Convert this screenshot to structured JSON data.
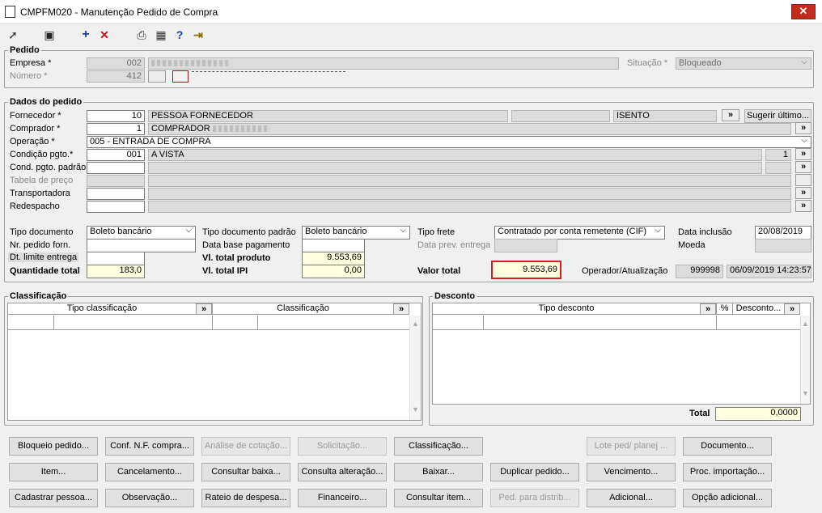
{
  "window": {
    "title": "CMPFM020 - Manutenção Pedido de Compra",
    "close": "✕"
  },
  "toolbar": {
    "arrow": "➚",
    "save": "▣",
    "add": "+",
    "delete": "✕",
    "print": "⎙",
    "grid": "▦",
    "help": "?",
    "exit": "⇥"
  },
  "pedido": {
    "group_label": "Pedido",
    "empresa_label": "Empresa *",
    "empresa_code": "002",
    "numero_label": "Número *",
    "numero_value": "412",
    "situacao_label": "Situação *",
    "situacao_value": "Bloqueado"
  },
  "dados": {
    "group_label": "Dados do pedido",
    "fornecedor_label": "Fornecedor *",
    "fornecedor_code": "10",
    "fornecedor_name": "PESSOA FORNECEDOR",
    "fornecedor_status": "ISENTO",
    "sugerir_button": "Sugerir último...",
    "comprador_label": "Comprador *",
    "comprador_code": "1",
    "comprador_name": "COMPRADOR",
    "operacao_label": "Operação *",
    "operacao_value": "005 - ENTRADA DE COMPRA",
    "condicao_label": "Condição pgto.*",
    "condicao_code": "001",
    "condicao_name": "A VISTA",
    "condicao_parcelas": "1",
    "cond_padrao_label": "Cond. pgto. padrão",
    "tabela_label": "Tabela de preço",
    "transportadora_label": "Transportadora",
    "redespacho_label": "Redespacho",
    "tipo_documento_label": "Tipo documento",
    "tipo_documento_value": "Boleto bancário",
    "tipo_documento_padrao_label": "Tipo documento padrão",
    "tipo_documento_padrao_value": "Boleto bancário",
    "tipo_frete_label": "Tipo frete",
    "tipo_frete_value": "Contratado por conta remetente (CIF)",
    "data_inclusao_label": "Data inclusão",
    "data_inclusao_value": "20/08/2019",
    "nr_pedido_label": "Nr. pedido forn.",
    "data_base_label": "Data base pagamento",
    "data_prev_label": "Data prev. entrega",
    "moeda_label": "Moeda",
    "dt_limite_label": "Dt. limite entrega",
    "vl_total_produto_label": "Vl. total produto",
    "vl_total_produto_value": "9.553,69",
    "quantidade_total_label": "Quantidade total",
    "quantidade_total_value": "183,0",
    "vl_total_ipi_label": "Vl. total IPI",
    "vl_total_ipi_value": "0,00",
    "valor_total_label": "Valor total",
    "valor_total_value": "9.553,69",
    "operador_label": "Operador/Atualização",
    "operador_value": "999998",
    "atualizacao_value": "06/09/2019 14:23:57"
  },
  "classificacao": {
    "group_label": "Classificação",
    "col1": "Tipo classificação",
    "col2": "Classificação"
  },
  "desconto": {
    "group_label": "Desconto",
    "col1": "Tipo desconto",
    "col2": "%",
    "col3": "Desconto...",
    "total_label": "Total",
    "total_value": "0,0000"
  },
  "expand": "»",
  "buttons": {
    "row1": [
      "Bloqueio pedido...",
      "Conf. N.F. compra...",
      "Análise de cotação...",
      "Solicitação...",
      "Classificação...",
      "Lote ped/ planej ...",
      "Documento..."
    ],
    "row2": [
      "Item...",
      "Cancelamento...",
      "Consultar baixa...",
      "Consulta alteração...",
      "Baixar...",
      "Duplicar pedido...",
      "Vencimento...",
      "Proc. importação..."
    ],
    "row3": [
      "Cadastrar pessoa...",
      "Observação...",
      "Rateio de despesa...",
      "Financeiro...",
      "Consultar item...",
      "Ped. para distrib...",
      "Adicional...",
      "Opção adicional..."
    ]
  }
}
